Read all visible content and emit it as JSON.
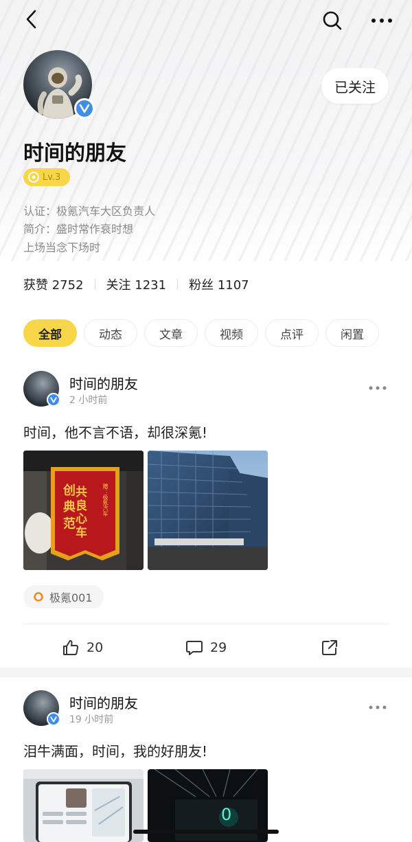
{
  "header": {
    "back_icon": "chevron-left-icon",
    "search_icon": "search-icon",
    "more_icon": "more-horizontal-icon"
  },
  "profile": {
    "name": "时间的朋友",
    "follow_label": "已关注",
    "level": "Lv.3",
    "certification": "认证：极氪汽车大区负责人",
    "bio_line1": "简介：盛时常作衰时想",
    "bio_line2": "上场当念下场时",
    "stats": {
      "likes_label": "获赞",
      "likes": "2752",
      "following_label": "关注",
      "following": "1231",
      "fans_label": "粉丝",
      "fans": "1107"
    }
  },
  "tabs": [
    {
      "label": "全部",
      "active": true
    },
    {
      "label": "动态",
      "active": false
    },
    {
      "label": "文章",
      "active": false
    },
    {
      "label": "视频",
      "active": false
    },
    {
      "label": "点评",
      "active": false
    },
    {
      "label": "闲置",
      "active": false
    }
  ],
  "posts": [
    {
      "author": "时间的朋友",
      "time": "2 小时前",
      "text": "时间，他不言不语，却很深氪!",
      "banner_text": {
        "line1": "共 良 心 车",
        "line2": "创 典 范",
        "side": "赠：极氪汽车"
      },
      "tag": "极氪001",
      "likes": "20",
      "comments": "29"
    },
    {
      "author": "时间的朋友",
      "time": "19 小时前",
      "text": "泪牛满面，时间，我的好朋友!",
      "screen_digit": "0"
    }
  ],
  "colors": {
    "accent_yellow": "#f7d64a",
    "verify_blue": "#3f8fe8",
    "text_primary": "#222222",
    "text_secondary": "#8a8a8a"
  }
}
